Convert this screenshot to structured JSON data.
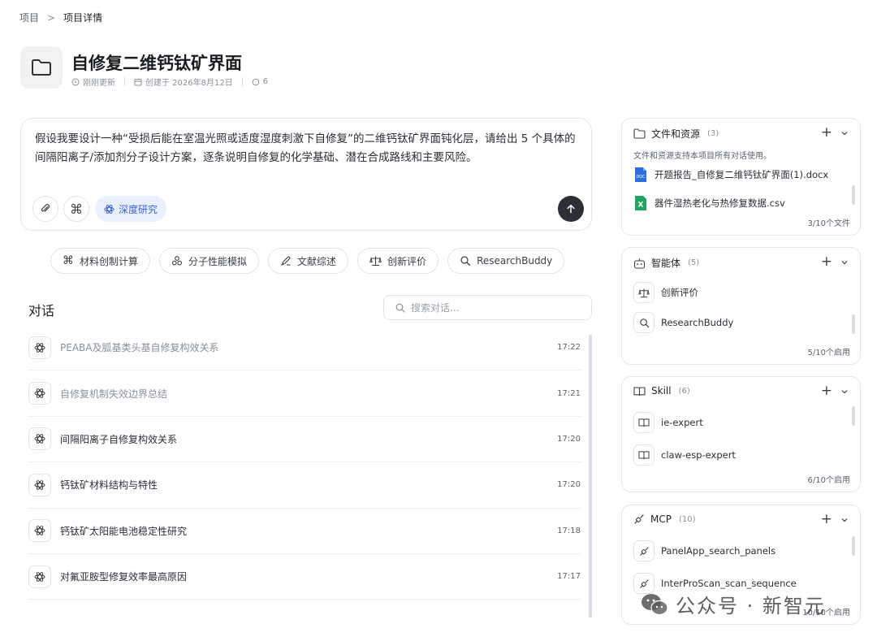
{
  "breadcrumb": {
    "root": "项目",
    "current": "项目详情"
  },
  "project": {
    "title": "自修复二维钙钛矿界面",
    "updated": "刚刚更新",
    "created": "创建于 2026年8月12日",
    "comments": "6"
  },
  "prompt": {
    "text": "假设我要设计一种“受损后能在室温光照或适度湿度刺激下自修复”的二维钙钛矿界面钝化层，请给出 5 个具体的间隔阳离子/添加剂分子设计方案，逐条说明自修复的化学基础、潜在合成路线和主要风险。",
    "deep_research_label": "深度研究"
  },
  "chips": [
    {
      "icon": "command-icon",
      "label": "材料创制计算"
    },
    {
      "icon": "molecule-icon",
      "label": "分子性能模拟"
    },
    {
      "icon": "pen-icon",
      "label": "文献综述"
    },
    {
      "icon": "scale-icon",
      "label": "创新评价"
    },
    {
      "icon": "magnifier-icon",
      "label": "ResearchBuddy"
    }
  ],
  "conversations": {
    "title": "对话",
    "search_placeholder": "搜索对话...",
    "items": [
      {
        "title": "PEABA及胍基类头基自修复构效关系",
        "time": "17:22",
        "dim": true
      },
      {
        "title": "自修复机制失效边界总结",
        "time": "17:21",
        "dim": true
      },
      {
        "title": "间隔阳离子自修复构效关系",
        "time": "17:20",
        "dim": false
      },
      {
        "title": "钙钛矿材料结构与特性",
        "time": "17:20",
        "dim": false
      },
      {
        "title": "钙钛矿太阳能电池稳定性研究",
        "time": "17:18",
        "dim": false
      },
      {
        "title": "对氟亚胺型修复效率最高原因",
        "time": "17:17",
        "dim": false
      }
    ]
  },
  "files_panel": {
    "title": "文件和资源",
    "count": "(3)",
    "desc": "文件和资源支持本项目所有对话使用。",
    "items": [
      {
        "name": "开题报告_自修复二维钙钛矿界面(1).docx",
        "type": "docx"
      },
      {
        "name": "器件湿热老化与热修复数据.csv",
        "type": "csv"
      }
    ],
    "footer": "3/10个文件"
  },
  "agents_panel": {
    "title": "智能体",
    "count": "(5)",
    "items": [
      {
        "name": "创新评价"
      },
      {
        "name": "ResearchBuddy"
      }
    ],
    "footer": "5/10个启用"
  },
  "skill_panel": {
    "title": "Skill",
    "count": "(6)",
    "items": [
      {
        "name": "ie-expert"
      },
      {
        "name": "claw-esp-expert"
      }
    ],
    "footer": "6/10个启用"
  },
  "mcp_panel": {
    "title": "MCP",
    "count": "(10)",
    "items": [
      {
        "name": "PanelApp_search_panels"
      },
      {
        "name": "InterProScan_scan_sequence"
      }
    ],
    "footer": "10/10个启用"
  },
  "watermark": {
    "text": "公众号 · 新智元"
  },
  "colors": {
    "accent": "#3d63d6",
    "accent_bg": "#eaf0ff",
    "send": "#2b2f36",
    "word": "#2b6fde",
    "excel": "#21a366"
  }
}
